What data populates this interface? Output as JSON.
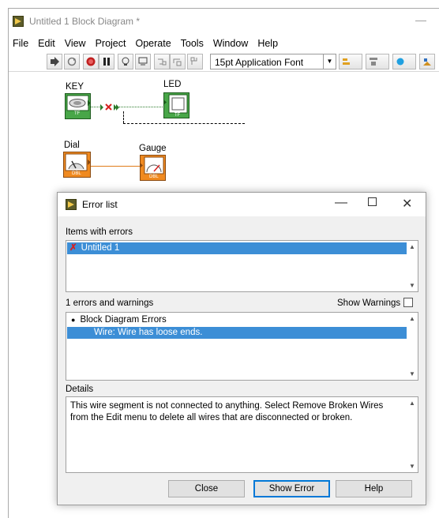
{
  "window": {
    "title": "Untitled 1 Block Diagram *",
    "minimize_glyph": "—"
  },
  "menu": [
    "File",
    "Edit",
    "View",
    "Project",
    "Operate",
    "Tools",
    "Window",
    "Help"
  ],
  "toolbar": {
    "font": "15pt Application Font"
  },
  "diagram": {
    "key_label": "KEY",
    "led_label": "LED",
    "dial_label": "Dial",
    "gauge_label": "Gauge",
    "tf_tag": "TF",
    "dbl_tag": "DBL"
  },
  "dialog": {
    "title": "Error list",
    "items_label": "Items with errors",
    "items": [
      "Untitled 1"
    ],
    "count_label": "1 errors and warnings",
    "show_warnings_label": "Show Warnings",
    "errors": {
      "group": "Block Diagram Errors",
      "entry": "Wire: Wire has loose ends."
    },
    "details_label": "Details",
    "details_text": "This wire segment is not connected to anything. Select Remove Broken Wires from the Edit menu to delete all wires that are disconnected or broken.",
    "buttons": {
      "close": "Close",
      "show_error": "Show Error",
      "help": "Help"
    }
  },
  "colors": {
    "accent": "#3c8ed6",
    "error": "#d62020",
    "bool_wire": "#2b7a2b",
    "dbl_wire": "#e07b1a"
  }
}
